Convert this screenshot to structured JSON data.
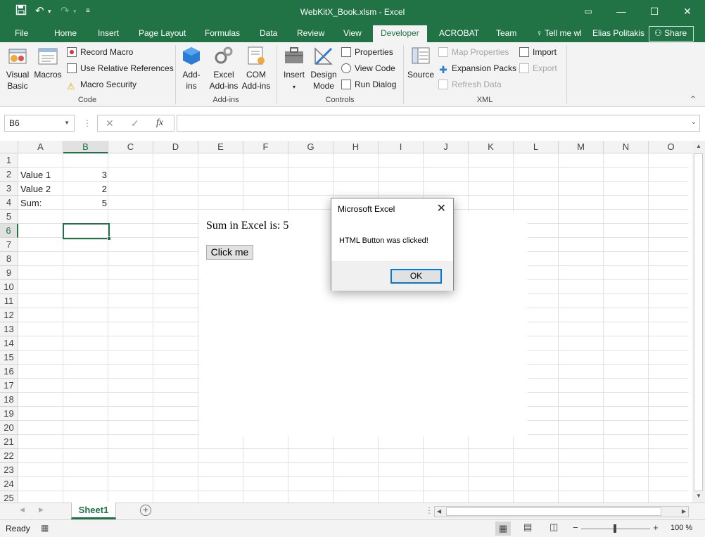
{
  "window": {
    "title": "WebKitX_Book.xlsm - Excel",
    "user": "Elias Politakis",
    "share_label": "Share"
  },
  "quick_access": {
    "save_icon": "save-icon",
    "undo_icon": "undo-icon",
    "redo_icon": "redo-icon",
    "customize_icon": "customize-icon"
  },
  "tabs": [
    "File",
    "Home",
    "Insert",
    "Page Layout",
    "Formulas",
    "Data",
    "Review",
    "View",
    "Developer",
    "ACROBAT",
    "Team"
  ],
  "active_tab": "Developer",
  "tell_me": "Tell me wl",
  "ribbon": {
    "code": {
      "label": "Code",
      "visual_basic": [
        "Visual",
        "Basic"
      ],
      "macros": "Macros",
      "record_macro": "Record Macro",
      "relative_refs": "Use Relative References",
      "macro_security": "Macro Security"
    },
    "addins": {
      "label": "Add-ins",
      "addins": [
        "Add-",
        "ins"
      ],
      "excel_addins": [
        "Excel",
        "Add-ins"
      ],
      "com_addins": [
        "COM",
        "Add-ins"
      ]
    },
    "controls": {
      "label": "Controls",
      "insert": "Insert",
      "design_mode": [
        "Design",
        "Mode"
      ],
      "properties": "Properties",
      "view_code": "View Code",
      "run_dialog": "Run Dialog"
    },
    "xml": {
      "label": "XML",
      "source": "Source",
      "map_properties": "Map Properties",
      "expansion_packs": "Expansion Packs",
      "refresh_data": "Refresh Data",
      "import": "Import",
      "export": "Export"
    }
  },
  "formula_bar": {
    "name_box": "B6",
    "fx": "fx",
    "formula": ""
  },
  "columns": [
    "A",
    "B",
    "C",
    "D",
    "E",
    "F",
    "G",
    "H",
    "I",
    "J",
    "K",
    "L",
    "M",
    "N",
    "O"
  ],
  "rows": [
    "1",
    "2",
    "3",
    "4",
    "5",
    "6",
    "7",
    "8",
    "9",
    "10",
    "11",
    "12",
    "13",
    "14",
    "15",
    "16",
    "17",
    "18",
    "19",
    "20",
    "21",
    "22",
    "23",
    "24",
    "25"
  ],
  "selected_cell": "B6",
  "cells": {
    "A2": "Value 1",
    "B2": "3",
    "A3": "Value 2",
    "B3": "2",
    "A4": "Sum:",
    "B4": "5"
  },
  "web_panel": {
    "sum_text": "Sum in Excel is: 5",
    "button_label": "Click me"
  },
  "dialog": {
    "title": "Microsoft Excel",
    "message": "HTML Button was clicked!",
    "ok_label": "OK"
  },
  "sheet_tab": "Sheet1",
  "status": {
    "text": "Ready",
    "zoom": "100 %"
  },
  "colors": {
    "accent": "#217346",
    "dialog_focus": "#0078d7"
  }
}
